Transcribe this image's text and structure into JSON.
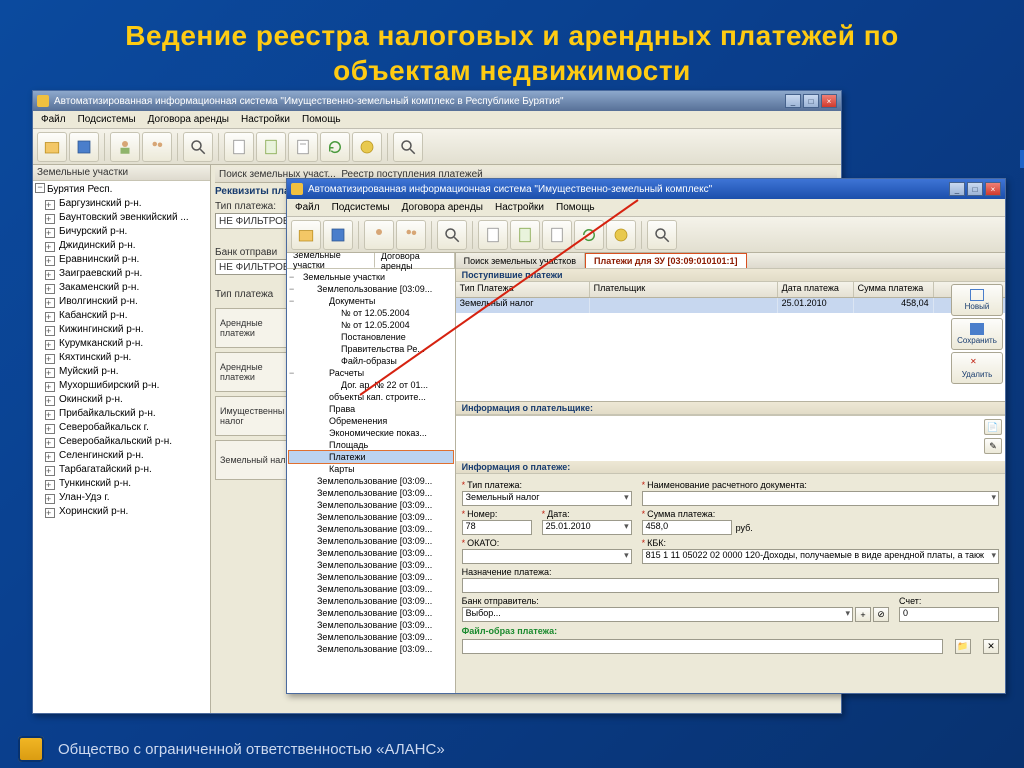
{
  "slide": {
    "title": "Ведение реестра налоговых и арендных платежей по объектам недвижимости",
    "footer": "Общество с ограниченной ответственностью «АЛАНС»"
  },
  "main_window": {
    "title": "Автоматизированная информационная система \"Имущественно-земельный комплекс в Республике Бурятия\"",
    "menu": [
      "Файл",
      "Подсистемы",
      "Договора аренды",
      "Настройки",
      "Помощь"
    ],
    "left_header": "Земельные участки",
    "tree_root": "Бурятия Респ.",
    "tree_items": [
      "Баргузинский р-н.",
      "Баунтовский эвенкийский ...",
      "Бичурский р-н.",
      "Джидинский р-н.",
      "Еравнинский р-н.",
      "Заиграевский р-н.",
      "Закаменский р-н.",
      "Иволгинский р-н.",
      "Кабанский р-н.",
      "Кижингинский р-н.",
      "Курумканский р-н.",
      "Кяхтинский р-н.",
      "Муйский р-н.",
      "Мухоршибирский р-н.",
      "Окинский р-н.",
      "Прибайкальский р-н.",
      "Северобайкальск г.",
      "Северобайкальский р-н.",
      "Селенгинский р-н.",
      "Тарбагатайский р-н.",
      "Тункинский р-н.",
      "Улан-Удэ г.",
      "Хоринский р-н."
    ],
    "center": {
      "tab1": "Поиск земельных участ...",
      "tab2": "Реестр поступления платежей",
      "req_label": "Реквизиты пла...",
      "type_label": "Тип платежа:",
      "type_value": "НЕ ФИЛЬТРОВАТ",
      "bank_label": "Банк отправи",
      "bank_value": "НЕ ФИЛЬТРОВ",
      "plat_label": "Тип платежа",
      "categories": [
        "Арендные платежи",
        "Арендные платежи",
        "Имущественны налог",
        "Земельный налог"
      ]
    }
  },
  "sub_window": {
    "title": "Автоматизированная информационная система \"Имущественно-земельный комплекс\"",
    "menu": [
      "Файл",
      "Подсистемы",
      "Договора аренды",
      "Настройки",
      "Помощь"
    ],
    "left_tabs": [
      "Земельные участки",
      "Договора аренды"
    ],
    "tree": {
      "root": "Земельные участки",
      "children": [
        {
          "label": "Землепользование [03:09...",
          "icon": "land",
          "children": [
            {
              "label": "Документы",
              "icon": "folder",
              "children": [
                {
                  "label": "№  от 12.05.2004",
                  "icon": "doc"
                },
                {
                  "label": "№  от 12.05.2004",
                  "icon": "doc"
                },
                {
                  "label": "Постановление Правительства Ре...",
                  "icon": "doc"
                },
                {
                  "label": "Файл-образы",
                  "icon": "doc"
                }
              ]
            },
            {
              "label": "Расчеты",
              "icon": "folder",
              "children": [
                {
                  "label": "Дог. ар. № 22 от 01...",
                  "icon": "doc"
                }
              ]
            },
            {
              "label": "объекты кап. строите...",
              "icon": "obj"
            },
            {
              "label": "Права",
              "icon": "rights"
            },
            {
              "label": "Обременения",
              "icon": "burden"
            },
            {
              "label": "Экономические показ...",
              "icon": "econ"
            },
            {
              "label": "Площадь",
              "icon": "area"
            },
            {
              "label": "Платежи",
              "icon": "payments",
              "selected": true
            },
            {
              "label": "Карты",
              "icon": "maps"
            }
          ]
        }
      ],
      "repeats_label": "Землепользование [03:09...",
      "repeats_count": 15
    },
    "right_tabs": {
      "search": "Поиск земельных участков",
      "pay": "Платежи для ЗУ [03:09:010101:1]"
    },
    "grid": {
      "header": "Поступившие платежи",
      "cols": [
        "Тип Платежа",
        "Плательщик",
        "Дата платежа",
        "Сумма платежа"
      ],
      "row": {
        "type": "Земельный налог",
        "payer": "",
        "date": "25.01.2010",
        "sum": "458,04"
      },
      "buttons": {
        "new": "Новый",
        "save": "Сохранить",
        "del": "Удалить"
      }
    },
    "payer_panel": "Информация о плательщике:",
    "payment_panel": "Информация о платеже:",
    "form": {
      "type_label": "Тип платежа:",
      "type_value": "Земельный налог",
      "docname_label": "Наименование расчетного документа:",
      "num_label": "Номер:",
      "num_value": "78",
      "date_label": "Дата:",
      "date_value": "25.01.2010",
      "sum_label": "Сумма платежа:",
      "sum_value": "458,0",
      "sum_unit": "руб.",
      "okato_label": "ОКАТО:",
      "kbk_label": "КБК:",
      "kbk_value": "815 1 11 05022 02 0000 120-Доходы, получаемые в виде арендной платы, а такж",
      "purpose_label": "Назначение платежа:",
      "bank_label": "Банк отправитель:",
      "bank_value": "Выбор...",
      "acct_label": "Счет:",
      "acct_value": "0",
      "file_label": "Файл-образ платежа:"
    }
  }
}
